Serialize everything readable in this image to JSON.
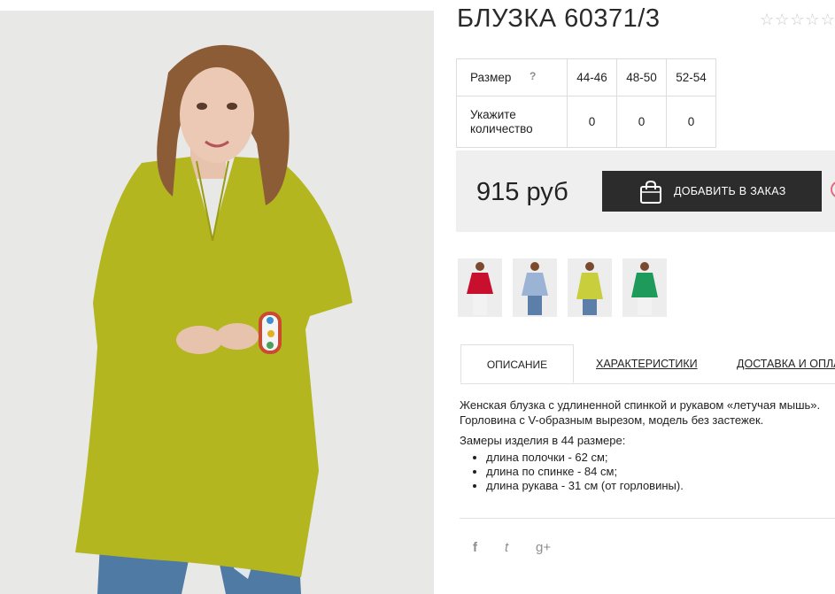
{
  "product": {
    "title": "БЛУЗКА 60371/3",
    "rating_stars": 5,
    "price": "915 руб"
  },
  "sizes_table": {
    "size_label": "Размер",
    "help": "?",
    "quantity_label": "Укажите количество",
    "sizes": [
      "44-46",
      "48-50",
      "52-54"
    ],
    "quantities": [
      "0",
      "0",
      "0"
    ]
  },
  "actions": {
    "add_to_order": "ДОБАВИТЬ В ЗАКАЗ"
  },
  "thumbnails": [
    {
      "name": "red",
      "color": "#c8102e"
    },
    {
      "name": "light-blue",
      "color": "#9bb4d6"
    },
    {
      "name": "yellow-green",
      "color": "#c9cf3c"
    },
    {
      "name": "green",
      "color": "#1e9a5a"
    }
  ],
  "tabs": [
    "ОПИСАНИЕ",
    "ХАРАКТЕРИСТИКИ",
    "ДОСТАВКА И ОПЛАТА"
  ],
  "description": {
    "text": "Женская блузка с удлиненной спинкой и рукавом «летучая мышь». Горловина с V-образным вырезом, модель без застежек.",
    "measures_title": "Замеры изделия в 44 размере:",
    "measures": [
      "длина полочки - 62 см;",
      "длина по спинке - 84 см;",
      "длина рукава - 31 см (от горловины)."
    ]
  },
  "social": [
    {
      "name": "facebook",
      "glyph": "f"
    },
    {
      "name": "twitter",
      "glyph": "t"
    },
    {
      "name": "google-plus",
      "glyph": "g+"
    }
  ],
  "colors": {
    "blouse": "#b3b61e",
    "button": "#2c2c2c",
    "price_bar": "#efefef",
    "jeans": "#4e7aa4"
  }
}
